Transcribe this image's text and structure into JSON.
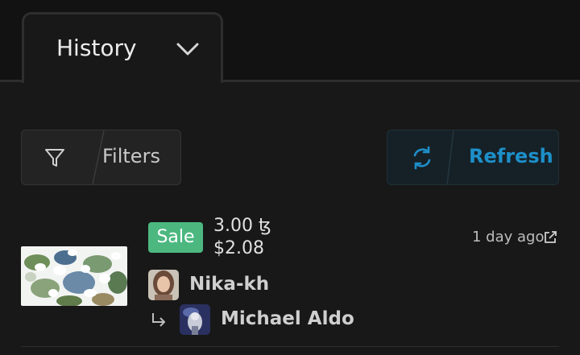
{
  "tab": {
    "label": "History"
  },
  "toolbar": {
    "filters_label": "Filters",
    "refresh_label": "Refresh",
    "refresh_color": "#1d8fc9"
  },
  "event": {
    "type": "Sale",
    "badge_color": "#4cb880",
    "price": "3.00 ꜩ",
    "price_usd": "$2.08",
    "time": "1 day ago",
    "from_user": "Nika-kh",
    "to_user": "Michael Aldo"
  },
  "icons": {
    "tab": "chevron-down-icon",
    "filters": "filter-icon",
    "refresh": "refresh-icon",
    "time": "external-link-icon",
    "transfer": "arrow-turn-right-icon"
  }
}
